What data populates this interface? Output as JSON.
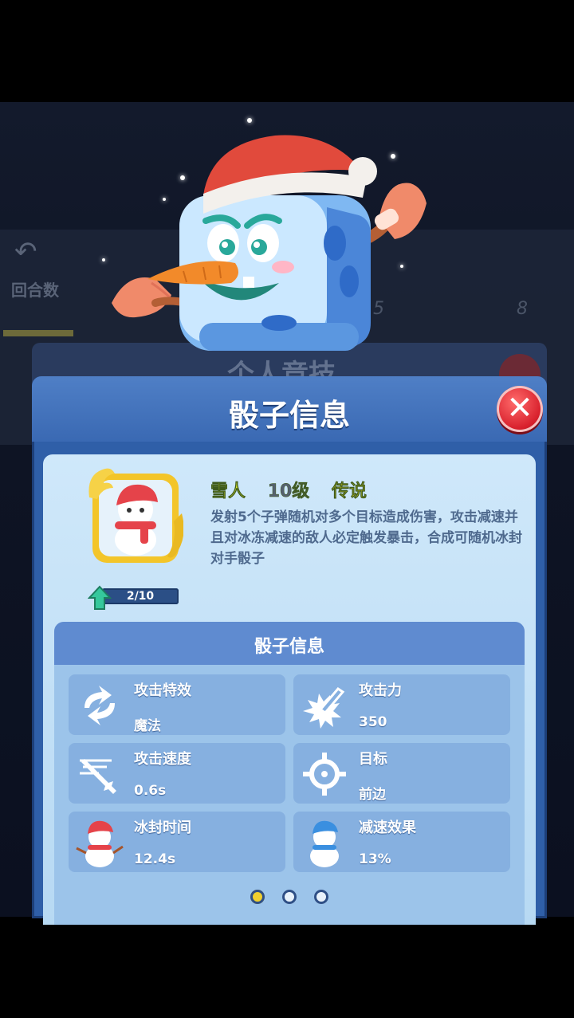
{
  "background": {
    "rounds_label": "回合数",
    "tick_5": "5",
    "tick_8": "8",
    "behind_title": "个人竞技"
  },
  "dialog": {
    "title": "骰子信息",
    "close_icon": "close-x-icon"
  },
  "dice": {
    "name": "雪人",
    "level": "10级",
    "rarity": "传说",
    "description": "发射5个子弹随机对多个目标造成伤害，攻击减速并且对冰冻减速的敌人必定触发暴击，合成可随机冰封对手骰子",
    "upgrade_progress": "2/10"
  },
  "info": {
    "title": "骰子信息",
    "stats": [
      {
        "label": "攻击特效",
        "value": "魔法",
        "icon": "swap-arrows-icon"
      },
      {
        "label": "攻击力",
        "value": "350",
        "icon": "sword-impact-icon"
      },
      {
        "label": "攻击速度",
        "value": "0.6s",
        "icon": "sword-speed-icon"
      },
      {
        "label": "目标",
        "value": "前边",
        "icon": "crosshair-icon"
      },
      {
        "label": "冰封时间",
        "value": "12.4s",
        "icon": "snowman-red-icon"
      },
      {
        "label": "减速效果",
        "value": "13%",
        "icon": "snowman-blue-icon"
      }
    ],
    "page_count": 3,
    "active_page": 1
  },
  "colors": {
    "gold_accent": "#f0cf2f",
    "dialog_blue": "#2f5fa8",
    "close_red": "#d8202c"
  }
}
